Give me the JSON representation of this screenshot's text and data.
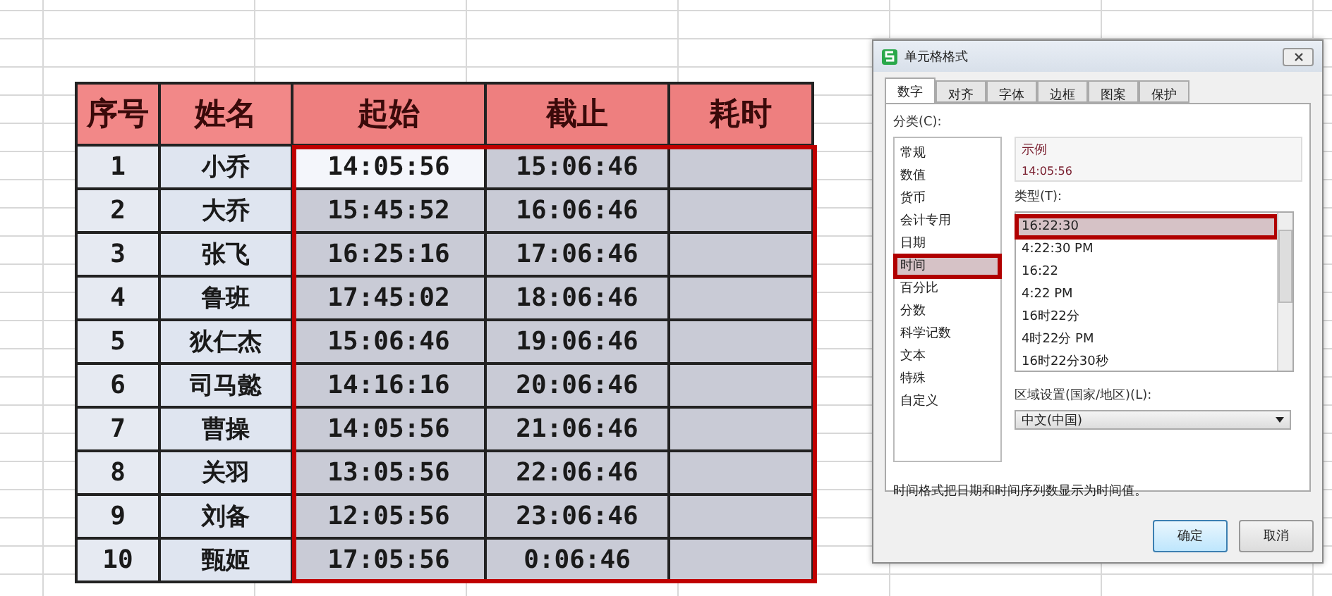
{
  "table": {
    "columns": [
      {
        "label": "序号",
        "selected": false
      },
      {
        "label": "姓名",
        "selected": false
      },
      {
        "label": "起始",
        "selected": true
      },
      {
        "label": "截止",
        "selected": true
      },
      {
        "label": "耗时",
        "selected": true
      }
    ],
    "rows": [
      {
        "cells": [
          "1",
          "小乔",
          "14:05:56",
          "15:06:46",
          ""
        ],
        "active": true
      },
      {
        "cells": [
          "2",
          "大乔",
          "15:45:52",
          "16:06:46",
          ""
        ],
        "active": false
      },
      {
        "cells": [
          "3",
          "张飞",
          "16:25:16",
          "17:06:46",
          ""
        ],
        "active": false
      },
      {
        "cells": [
          "4",
          "鲁班",
          "17:45:02",
          "18:06:46",
          ""
        ],
        "active": false
      },
      {
        "cells": [
          "5",
          "狄仁杰",
          "15:06:46",
          "19:06:46",
          ""
        ],
        "active": false
      },
      {
        "cells": [
          "6",
          "司马懿",
          "14:16:16",
          "20:06:46",
          ""
        ],
        "active": false
      },
      {
        "cells": [
          "7",
          "曹操",
          "14:05:56",
          "21:06:46",
          ""
        ],
        "active": false
      },
      {
        "cells": [
          "8",
          "关羽",
          "13:05:56",
          "22:06:46",
          ""
        ],
        "active": false
      },
      {
        "cells": [
          "9",
          "刘备",
          "12:05:56",
          "23:06:46",
          ""
        ],
        "active": false
      },
      {
        "cells": [
          "10",
          "甄姬",
          "17:05:56",
          "0:06:46",
          ""
        ],
        "active": false
      }
    ]
  },
  "dialog": {
    "title": "单元格格式",
    "tabs": [
      {
        "label": "数字",
        "selected": true
      },
      {
        "label": "对齐",
        "selected": false
      },
      {
        "label": "字体",
        "selected": false
      },
      {
        "label": "边框",
        "selected": false
      },
      {
        "label": "图案",
        "selected": false
      },
      {
        "label": "保护",
        "selected": false
      }
    ],
    "category_label": "分类(C):",
    "categories": [
      {
        "label": "常规",
        "selected": false
      },
      {
        "label": "数值",
        "selected": false
      },
      {
        "label": "货币",
        "selected": false
      },
      {
        "label": "会计专用",
        "selected": false
      },
      {
        "label": "日期",
        "selected": false
      },
      {
        "label": "时间",
        "selected": true
      },
      {
        "label": "百分比",
        "selected": false
      },
      {
        "label": "分数",
        "selected": false
      },
      {
        "label": "科学记数",
        "selected": false
      },
      {
        "label": "文本",
        "selected": false
      },
      {
        "label": "特殊",
        "selected": false
      },
      {
        "label": "自定义",
        "selected": false
      }
    ],
    "sample": {
      "label": "示例",
      "value": "14:05:56"
    },
    "type_label": "类型(T):",
    "types": [
      {
        "label": "16:22:30",
        "selected": true
      },
      {
        "label": "4:22:30 PM",
        "selected": false
      },
      {
        "label": "16:22",
        "selected": false
      },
      {
        "label": "4:22 PM",
        "selected": false
      },
      {
        "label": "16时22分",
        "selected": false
      },
      {
        "label": "4时22分 PM",
        "selected": false
      },
      {
        "label": "16时22分30秒",
        "selected": false
      }
    ],
    "locale_label": "区域设置(国家/地区)(L):",
    "locale_value": "中文(中国)",
    "description": "时间格式把日期和时间序列数显示为时间值。",
    "buttons": [
      {
        "label": "确定",
        "kind": "primary"
      },
      {
        "label": "取消",
        "kind": "normal"
      }
    ]
  }
}
